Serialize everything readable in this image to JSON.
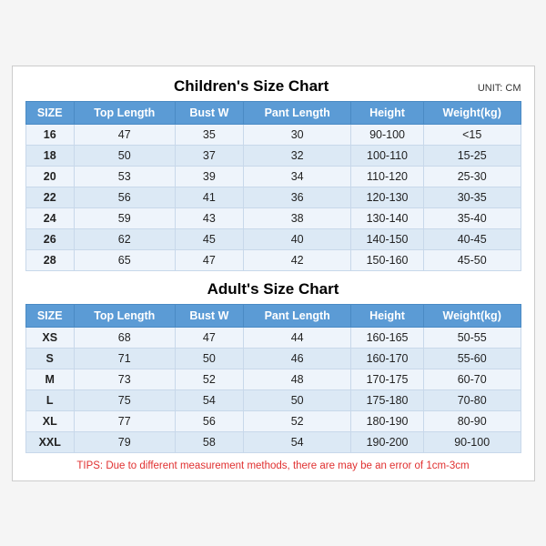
{
  "children_chart": {
    "title": "Children's Size Chart",
    "unit": "UNIT: CM",
    "headers": [
      "SIZE",
      "Top Length",
      "Bust W",
      "Pant Length",
      "Height",
      "Weight(kg)"
    ],
    "rows": [
      [
        "16",
        "47",
        "35",
        "30",
        "90-100",
        "<15"
      ],
      [
        "18",
        "50",
        "37",
        "32",
        "100-110",
        "15-25"
      ],
      [
        "20",
        "53",
        "39",
        "34",
        "110-120",
        "25-30"
      ],
      [
        "22",
        "56",
        "41",
        "36",
        "120-130",
        "30-35"
      ],
      [
        "24",
        "59",
        "43",
        "38",
        "130-140",
        "35-40"
      ],
      [
        "26",
        "62",
        "45",
        "40",
        "140-150",
        "40-45"
      ],
      [
        "28",
        "65",
        "47",
        "42",
        "150-160",
        "45-50"
      ]
    ]
  },
  "adult_chart": {
    "title": "Adult's Size Chart",
    "headers": [
      "SIZE",
      "Top Length",
      "Bust W",
      "Pant Length",
      "Height",
      "Weight(kg)"
    ],
    "rows": [
      [
        "XS",
        "68",
        "47",
        "44",
        "160-165",
        "50-55"
      ],
      [
        "S",
        "71",
        "50",
        "46",
        "160-170",
        "55-60"
      ],
      [
        "M",
        "73",
        "52",
        "48",
        "170-175",
        "60-70"
      ],
      [
        "L",
        "75",
        "54",
        "50",
        "175-180",
        "70-80"
      ],
      [
        "XL",
        "77",
        "56",
        "52",
        "180-190",
        "80-90"
      ],
      [
        "XXL",
        "79",
        "58",
        "54",
        "190-200",
        "90-100"
      ]
    ]
  },
  "tips": "TIPS: Due to different measurement methods, there are may be an error of 1cm-3cm"
}
